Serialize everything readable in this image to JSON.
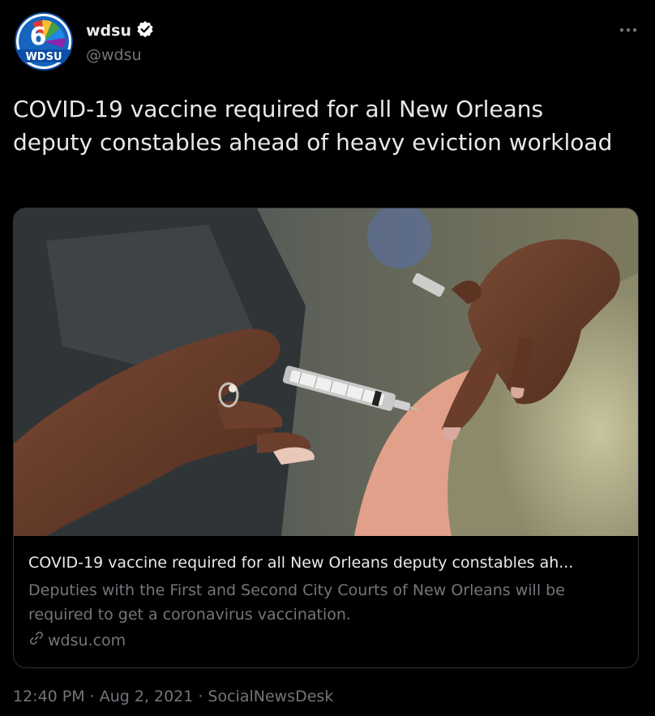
{
  "account": {
    "name": "wdsu",
    "handle": "@wdsu",
    "avatar_text": "WDSU",
    "avatar_number": "6"
  },
  "more_icon": "more-horizontal-icon",
  "tweet": {
    "text": "COVID-19 vaccine required for all New Orleans deputy constables ahead of heavy eviction workload"
  },
  "card": {
    "title": "COVID-19 vaccine required for all New Orleans deputy constables ah...",
    "description": "Deputies with the First and Second City Courts of New Orleans will be required to get a coronavirus vaccination.",
    "domain": "wdsu.com"
  },
  "footer": {
    "time": "12:40 PM",
    "sep": "·",
    "date": "Aug 2, 2021",
    "source": "SocialNewsDesk"
  },
  "colors": {
    "background": "#000000",
    "text_primary": "#e7e9ea",
    "text_secondary": "#71767b",
    "border": "#2f3336",
    "verified": "#ffffff"
  }
}
